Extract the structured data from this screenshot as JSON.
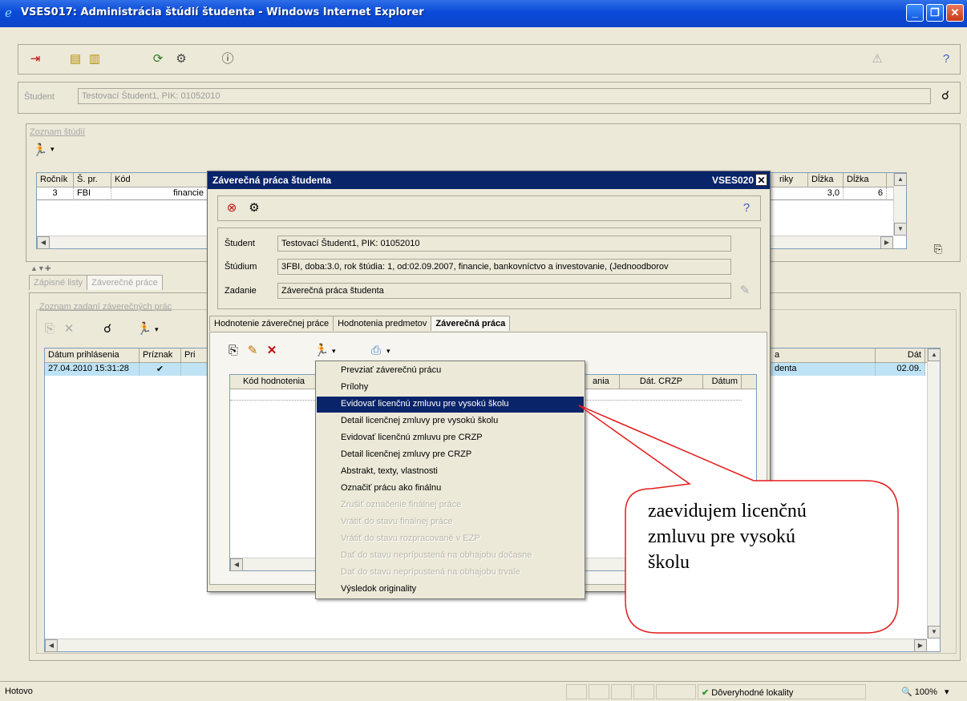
{
  "window": {
    "title": "VSES017: Administrácia štúdií študenta - Windows Internet Explorer",
    "controls": [
      "_",
      "❐",
      "✕"
    ]
  },
  "student_bar": {
    "label": "Študent",
    "value": "Testovací Študent1, PIK: 01052010"
  },
  "studies": {
    "group_title": "Zoznam štúdií",
    "left_headers": [
      "Ročník",
      "Š. pr.",
      "Kód"
    ],
    "right_headers": [
      "riky",
      "Dĺžka",
      "Dĺžka"
    ],
    "row": {
      "rocnik": "3",
      "spr": "FBI",
      "kod": "financie",
      "dlzka1": "3,0",
      "dlzka2": "6"
    }
  },
  "lower_tabs": [
    "Zápisné listy",
    "Záverečné práce"
  ],
  "theses": {
    "group_title": "Zoznam zadaní záverečných prác",
    "headers": [
      "Dátum prihlásenia",
      "Príznak",
      "Pri"
    ],
    "right_headers": [
      "a",
      "Dát"
    ],
    "row": {
      "datum": "27.04.2010 15:31:28",
      "priznak": "✔",
      "right1": "denta",
      "right2": "02.09."
    }
  },
  "dialog": {
    "title": "Záverečná práca študenta",
    "code": "VSES020",
    "fields": [
      {
        "label": "Študent",
        "value": "Testovací Študent1, PIK: 01052010"
      },
      {
        "label": "Štúdium",
        "value": "3FBI, doba:3.0, rok štúdia: 1, od:02.09.2007, financie, bankovníctvo a investovanie, (Jednoodborov"
      },
      {
        "label": "Zadanie",
        "value": "Záverečná práca študenta"
      }
    ],
    "tabs": [
      "Hodnotenie záverečnej práce",
      "Hodnotenia predmetov",
      "Záverečná práca"
    ],
    "grid_headers": [
      "Kód hodnotenia",
      "ania",
      "Dát. CRZP",
      "Dátum"
    ]
  },
  "context_menu": {
    "items": [
      {
        "label": "Prevziať záverečnú prácu",
        "state": "enabled"
      },
      {
        "label": "Prílohy",
        "state": "enabled"
      },
      {
        "label": "Evidovať licenčnú zmluvu pre vysokú školu",
        "state": "selected"
      },
      {
        "label": "Detail licenčnej zmluvy pre vysokú školu",
        "state": "enabled"
      },
      {
        "label": "Evidovať licenčnú zmluvu pre CRZP",
        "state": "enabled"
      },
      {
        "label": "Detail licenčnej zmluvy pre CRZP",
        "state": "enabled"
      },
      {
        "label": "Abstrakt, texty, vlastnosti",
        "state": "enabled"
      },
      {
        "label": "Označiť prácu ako finálnu",
        "state": "enabled"
      },
      {
        "label": "Zrušiť označenie finálnej práce",
        "state": "disabled"
      },
      {
        "label": "Vrátiť do stavu finálnej práce",
        "state": "disabled"
      },
      {
        "label": "Vrátiť do stavu rozpracované v EZP",
        "state": "disabled"
      },
      {
        "label": "Dať do stavu neprípustená na obhajobu dočasne",
        "state": "disabled"
      },
      {
        "label": "Dať do stavu neprípustená na obhajobu trvale",
        "state": "disabled"
      },
      {
        "label": "Výsledok originality",
        "state": "enabled"
      }
    ]
  },
  "callout": {
    "line1": "zaevidujem licenčnú",
    "line2": "zmluvu pre vysokú",
    "line3": "školu",
    "color": "#e31b1b"
  },
  "statusbar": {
    "status": "Hotovo",
    "zone": "Dôveryhodné lokality",
    "zoom": "100%"
  },
  "icons": {
    "exit": "exit-icon",
    "print": "print-icon",
    "refresh": "refresh-icon",
    "info": "info-icon",
    "warning": "warning-icon",
    "help": "help-icon",
    "search": "search-icon",
    "runner": "runner-icon"
  }
}
